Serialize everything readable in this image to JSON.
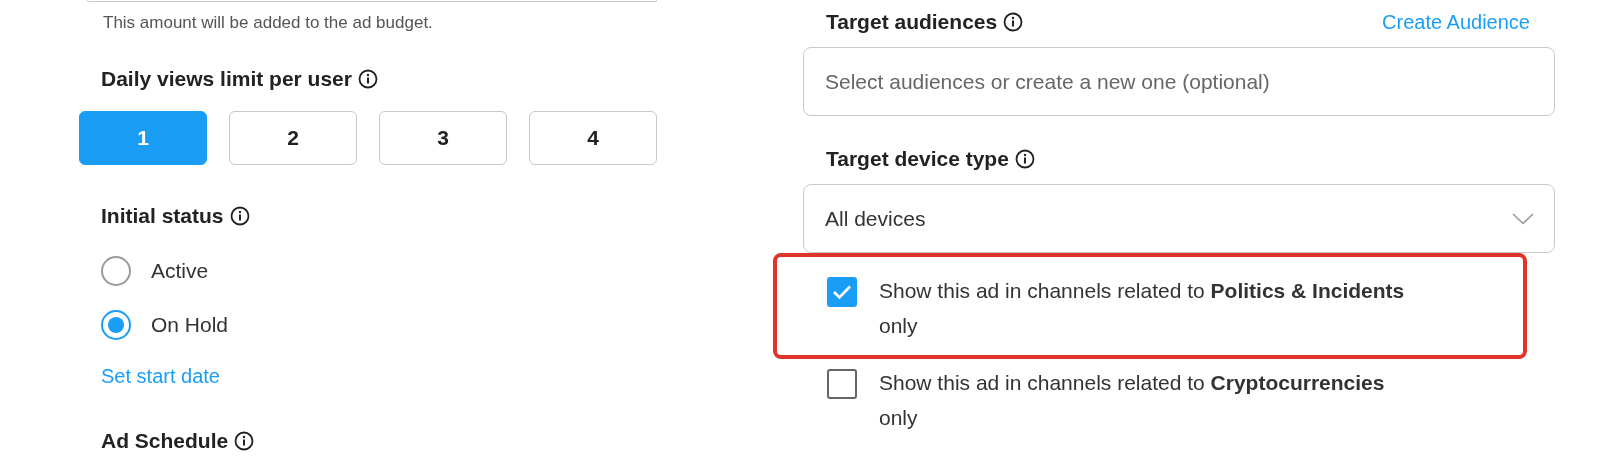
{
  "budget_note": "This amount will be added to the ad budget.",
  "daily_views": {
    "label": "Daily views limit per user",
    "options": [
      {
        "label": "1",
        "selected": true
      },
      {
        "label": "2",
        "selected": false
      },
      {
        "label": "3",
        "selected": false
      },
      {
        "label": "4",
        "selected": false
      }
    ]
  },
  "initial_status": {
    "label": "Initial status",
    "options": [
      {
        "label": "Active",
        "selected": false
      },
      {
        "label": "On Hold",
        "selected": true
      }
    ]
  },
  "start_date_link": "Set start date",
  "ad_schedule": {
    "label": "Ad Schedule"
  },
  "target_audiences": {
    "label": "Target audiences",
    "link": "Create Audience",
    "placeholder": "Select audiences or create a new one (optional)"
  },
  "target_device": {
    "label": "Target device type",
    "value": "All devices"
  },
  "channel_options": [
    {
      "text": "Show this ad in channels related to **Politics & Incidents** only",
      "checked": true,
      "highlighted": true
    },
    {
      "text": "Show this ad in channels related to **Cryptocurrencies** only",
      "checked": false,
      "highlighted": false
    }
  ]
}
